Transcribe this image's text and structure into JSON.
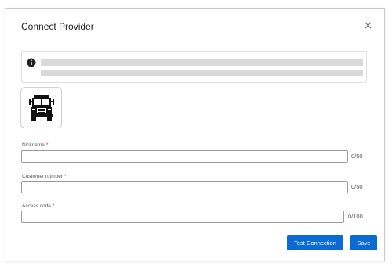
{
  "dialog": {
    "title": "Connect Provider",
    "close_icon": "close-icon"
  },
  "info_banner": {
    "icon": "info-icon"
  },
  "provider": {
    "logo_icon": "truck-icon"
  },
  "fields": {
    "nickname": {
      "label": "Nickname",
      "required_mark": "*",
      "value": "",
      "counter": "0/50"
    },
    "customer_number": {
      "label": "Customer number",
      "required_mark": "*",
      "value": "",
      "counter": "0/50"
    },
    "access_code": {
      "label": "Access code",
      "required_mark": "*",
      "value": "",
      "counter": "0/100"
    }
  },
  "footer": {
    "test_connection_label": "Test Connection",
    "save_label": "Save"
  },
  "colors": {
    "primary": "#0b6ad4",
    "required": "#d0342c"
  }
}
